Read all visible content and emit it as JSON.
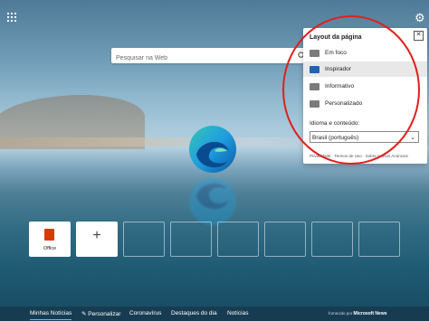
{
  "search": {
    "placeholder": "Pesquisar na Web"
  },
  "icons": {
    "apps": "apps-grid-icon",
    "settings": "gear-icon",
    "search": "search-icon",
    "close": "close-icon",
    "office": "office-icon",
    "add": "plus-icon"
  },
  "settings_panel": {
    "title": "Layout da página",
    "options": [
      {
        "label": "Em foco",
        "selected": false
      },
      {
        "label": "Inspirador",
        "selected": true
      },
      {
        "label": "Informativo",
        "selected": false
      },
      {
        "label": "Personalizado",
        "selected": false
      }
    ],
    "language_label": "Idioma e conteúdo:",
    "language_value": "Brasil (português)",
    "footer": "Privacidade · Termos de Uso · Sobre nossos Anúncios"
  },
  "quick_links": {
    "office_label": "Office",
    "add_label": "+"
  },
  "nav": {
    "items": [
      {
        "label": "Minhas Notícias",
        "active": true
      },
      {
        "label": "✎ Personalizar",
        "active": false
      },
      {
        "label": "Coronavírus",
        "active": false
      },
      {
        "label": "Destaques do dia",
        "active": false
      },
      {
        "label": "Notícias",
        "active": false
      }
    ],
    "powered_prefix": "fornecido por",
    "powered_brand": "Microsoft News"
  },
  "colors": {
    "accent": "#1f63b3",
    "highlight_circle": "#e0201c",
    "navbar": "#173c52"
  }
}
